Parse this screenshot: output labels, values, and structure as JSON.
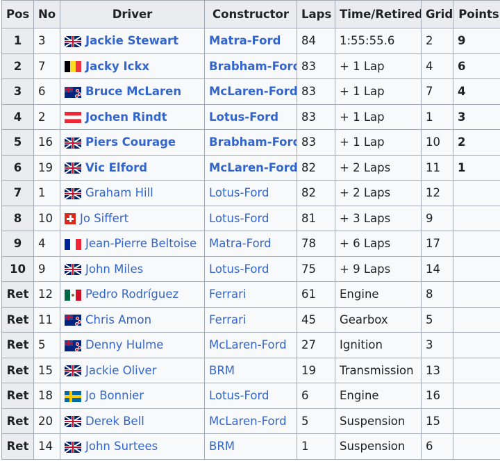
{
  "headers": {
    "pos": "Pos",
    "no": "No",
    "driver": "Driver",
    "constructor": "Constructor",
    "laps": "Laps",
    "time": "Time/Retired",
    "grid": "Grid",
    "points": "Points"
  },
  "rows": [
    {
      "pos": "1",
      "no": "3",
      "flag": "gbr",
      "driver": "Jackie Stewart",
      "constructor": "Matra-Ford",
      "laps": "84",
      "time": "1:55:55.6",
      "grid": "2",
      "points": "9"
    },
    {
      "pos": "2",
      "no": "7",
      "flag": "bel",
      "driver": "Jacky Ickx",
      "constructor": "Brabham-Ford",
      "laps": "83",
      "time": "+ 1 Lap",
      "grid": "4",
      "points": "6"
    },
    {
      "pos": "3",
      "no": "6",
      "flag": "nzl",
      "driver": "Bruce McLaren",
      "constructor": "McLaren-Ford",
      "laps": "83",
      "time": "+ 1 Lap",
      "grid": "7",
      "points": "4"
    },
    {
      "pos": "4",
      "no": "2",
      "flag": "aut",
      "driver": "Jochen Rindt",
      "constructor": "Lotus-Ford",
      "laps": "83",
      "time": "+ 1 Lap",
      "grid": "1",
      "points": "3"
    },
    {
      "pos": "5",
      "no": "16",
      "flag": "gbr",
      "driver": "Piers Courage",
      "constructor": "Brabham-Ford",
      "laps": "83",
      "time": "+ 1 Lap",
      "grid": "10",
      "points": "2"
    },
    {
      "pos": "6",
      "no": "19",
      "flag": "gbr",
      "driver": "Vic Elford",
      "constructor": "McLaren-Ford",
      "laps": "82",
      "time": "+ 2 Laps",
      "grid": "11",
      "points": "1"
    },
    {
      "pos": "7",
      "no": "1",
      "flag": "gbr",
      "driver": "Graham Hill",
      "constructor": "Lotus-Ford",
      "laps": "82",
      "time": "+ 2 Laps",
      "grid": "12",
      "points": ""
    },
    {
      "pos": "8",
      "no": "10",
      "flag": "sui",
      "driver": "Jo Siffert",
      "constructor": "Lotus-Ford",
      "laps": "81",
      "time": "+ 3 Laps",
      "grid": "9",
      "points": ""
    },
    {
      "pos": "9",
      "no": "4",
      "flag": "fra",
      "driver": "Jean-Pierre Beltoise",
      "constructor": "Matra-Ford",
      "laps": "78",
      "time": "+ 6 Laps",
      "grid": "17",
      "points": ""
    },
    {
      "pos": "10",
      "no": "9",
      "flag": "gbr",
      "driver": "John Miles",
      "constructor": "Lotus-Ford",
      "laps": "75",
      "time": "+ 9 Laps",
      "grid": "14",
      "points": ""
    },
    {
      "pos": "Ret",
      "no": "12",
      "flag": "mex",
      "driver": "Pedro Rodríguez",
      "constructor": "Ferrari",
      "laps": "61",
      "time": "Engine",
      "grid": "8",
      "points": ""
    },
    {
      "pos": "Ret",
      "no": "11",
      "flag": "nzl",
      "driver": "Chris Amon",
      "constructor": "Ferrari",
      "laps": "45",
      "time": "Gearbox",
      "grid": "5",
      "points": ""
    },
    {
      "pos": "Ret",
      "no": "5",
      "flag": "nzl",
      "driver": "Denny Hulme",
      "constructor": "McLaren-Ford",
      "laps": "27",
      "time": "Ignition",
      "grid": "3",
      "points": ""
    },
    {
      "pos": "Ret",
      "no": "15",
      "flag": "gbr",
      "driver": "Jackie Oliver",
      "constructor": "BRM",
      "laps": "19",
      "time": "Transmission",
      "grid": "13",
      "points": ""
    },
    {
      "pos": "Ret",
      "no": "18",
      "flag": "swe",
      "driver": "Jo Bonnier",
      "constructor": "Lotus-Ford",
      "laps": "6",
      "time": "Engine",
      "grid": "16",
      "points": ""
    },
    {
      "pos": "Ret",
      "no": "20",
      "flag": "gbr",
      "driver": "Derek Bell",
      "constructor": "McLaren-Ford",
      "laps": "5",
      "time": "Suspension",
      "grid": "15",
      "points": ""
    },
    {
      "pos": "Ret",
      "no": "14",
      "flag": "gbr",
      "driver": "John Surtees",
      "constructor": "BRM",
      "laps": "1",
      "time": "Suspension",
      "grid": "6",
      "points": ""
    }
  ]
}
